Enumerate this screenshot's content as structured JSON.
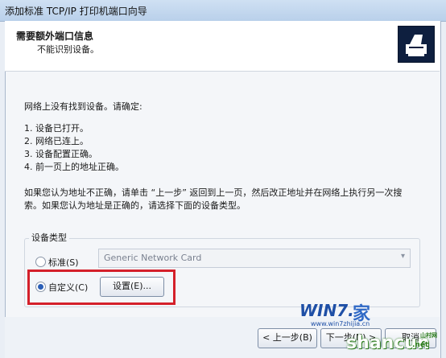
{
  "window": {
    "title": "添加标准 TCP/IP 打印机端口向导"
  },
  "header": {
    "title": "需要额外端口信息",
    "subtitle": "不能识别设备。"
  },
  "body": {
    "intro": "网络上没有找到设备。请确定:",
    "checklist": [
      "1.  设备已打开。",
      "2.  网络已连上。",
      "3.  设备配置正确。",
      "4.  前一页上的地址正确。"
    ],
    "para_line1": "如果您认为地址不正确，请单击 “上一步” 返回到上一页，然后改正地址并在网络上执行另一次搜",
    "para_line2": "索。如果您认为地址是正确的，请选择下面的设备类型。"
  },
  "device_type": {
    "group_label": "设备类型",
    "standard": {
      "label": "标准(S)",
      "selected": false,
      "select_value": "Generic Network Card"
    },
    "custom": {
      "label": "自定义(C)",
      "selected": true,
      "settings_button": "设置(E)..."
    }
  },
  "footer": {
    "back_button": "< 上一步(B)",
    "next_button": "下一步(N) >",
    "cancel_button": "取消"
  },
  "watermark": {
    "win7": "WIN7.",
    "home": "家",
    "url": "www.win7zhijia.cn",
    "shancun": "shancun",
    "net": ".net",
    "site_tag": "山村网"
  },
  "colors": {
    "highlight_border": "#d4202a",
    "radio_fill": "#2b5fb7",
    "icon_bg": "#0e1f3f"
  }
}
